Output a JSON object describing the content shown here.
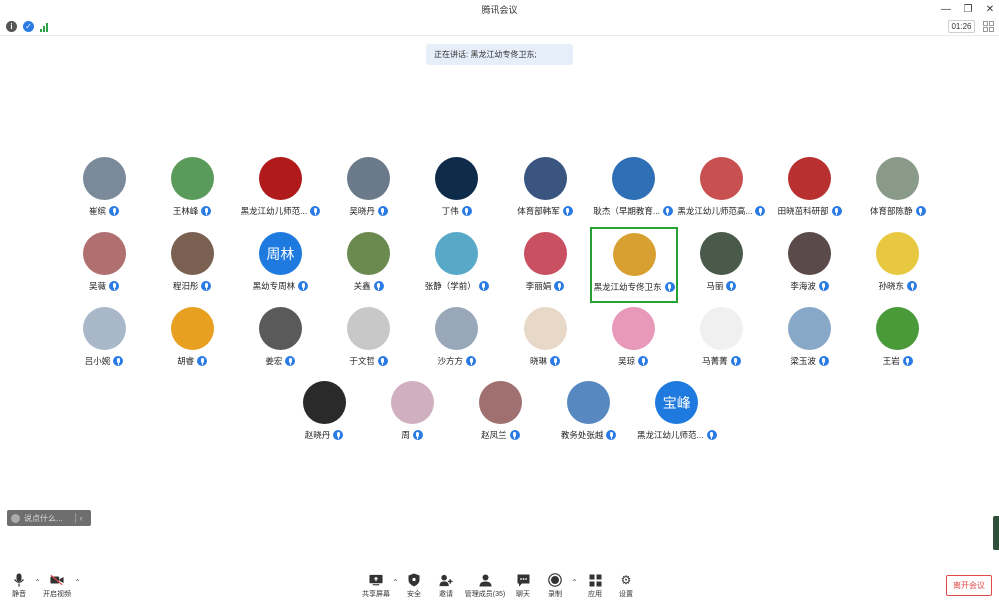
{
  "window": {
    "title": "腾讯会议"
  },
  "infobar": {
    "timer": "01:26"
  },
  "speaking": {
    "text": "正在讲话: 黑龙江幼专佟卫东;"
  },
  "colors": {
    "accent": "#2b7be5",
    "active_border": "#25a233",
    "leave_red": "#e24b4b"
  },
  "participants": [
    {
      "name": "崔缤",
      "avatar_text": "",
      "avatar_color": "#7a8a9a"
    },
    {
      "name": "王林峰",
      "avatar_text": "",
      "avatar_color": "#5a9a5a"
    },
    {
      "name": "黑龙江幼儿师范...",
      "avatar_text": "",
      "avatar_color": "#b01a1a"
    },
    {
      "name": "吴晓丹",
      "avatar_text": "",
      "avatar_color": "#6a7a8a"
    },
    {
      "name": "丁伟",
      "avatar_text": "",
      "avatar_color": "#0f2b4a"
    },
    {
      "name": "体育部韩军",
      "avatar_text": "",
      "avatar_color": "#3a5580"
    },
    {
      "name": "耿杰（早期教育...",
      "avatar_text": "",
      "avatar_color": "#2e6fb5"
    },
    {
      "name": "黑龙江幼儿师范高...",
      "avatar_text": "",
      "avatar_color": "#c85050"
    },
    {
      "name": "田晓茁科研部",
      "avatar_text": "",
      "avatar_color": "#b83030"
    },
    {
      "name": "体育部陈静",
      "avatar_text": "",
      "avatar_color": "#8a9a88"
    },
    {
      "name": "吴薇",
      "avatar_text": "",
      "avatar_color": "#b07070"
    },
    {
      "name": "程汨彤",
      "avatar_text": "",
      "avatar_color": "#7a6050"
    },
    {
      "name": "黑幼专周林",
      "avatar_text": "周林",
      "avatar_color": "#1f7ae0"
    },
    {
      "name": "关鑫",
      "avatar_text": "",
      "avatar_color": "#6a8a50"
    },
    {
      "name": "张静（学前）",
      "avatar_text": "",
      "avatar_color": "#58a8c8"
    },
    {
      "name": "李丽娟",
      "avatar_text": "",
      "avatar_color": "#c85060"
    },
    {
      "name": "黑龙江幼专佟卫东",
      "avatar_text": "",
      "avatar_color": "#d8a030"
    },
    {
      "name": "马丽",
      "avatar_text": "",
      "avatar_color": "#4a5a4a"
    },
    {
      "name": "李海波",
      "avatar_text": "",
      "avatar_color": "#5a4a4a"
    },
    {
      "name": "孙晓东",
      "avatar_text": "",
      "avatar_color": "#e8c840"
    },
    {
      "name": "吕小婉",
      "avatar_text": "",
      "avatar_color": "#a8b8c8"
    },
    {
      "name": "胡睿",
      "avatar_text": "",
      "avatar_color": "#e8a020"
    },
    {
      "name": "姜宏",
      "avatar_text": "",
      "avatar_color": "#5a5a5a"
    },
    {
      "name": "于文哲",
      "avatar_text": "",
      "avatar_color": "#c8c8c8"
    },
    {
      "name": "沙方方",
      "avatar_text": "",
      "avatar_color": "#98a8b8"
    },
    {
      "name": "晓琳",
      "avatar_text": "",
      "avatar_color": "#e8d8c8"
    },
    {
      "name": "吴琼",
      "avatar_text": "",
      "avatar_color": "#e898b8"
    },
    {
      "name": "马菁菁",
      "avatar_text": "",
      "avatar_color": "#f0f0f0"
    },
    {
      "name": "梁玉波",
      "avatar_text": "",
      "avatar_color": "#88a8c8"
    },
    {
      "name": "王岩",
      "avatar_text": "",
      "avatar_color": "#4a9a3a"
    },
    {
      "name": "赵晓丹",
      "avatar_text": "",
      "avatar_color": "#2a2a2a"
    },
    {
      "name": "周",
      "avatar_text": "",
      "avatar_color": "#d0b0c0"
    },
    {
      "name": "赵凤兰",
      "avatar_text": "",
      "avatar_color": "#a07070"
    },
    {
      "name": "教务处张越",
      "avatar_text": "",
      "avatar_color": "#5888c0"
    },
    {
      "name": "黑龙江幼儿师范...",
      "avatar_text": "宝峰",
      "avatar_color": "#1f7ae0"
    }
  ],
  "active_participant_index": 16,
  "chat": {
    "placeholder": "说点什么..."
  },
  "toolbar": {
    "mute": "静音",
    "video": "开启视频",
    "share": "共享屏幕",
    "security": "安全",
    "invite": "邀请",
    "members": "管理成员(35)",
    "chat": "聊天",
    "record": "录制",
    "apps": "应用",
    "settings": "设置",
    "leave": "离开会议"
  }
}
